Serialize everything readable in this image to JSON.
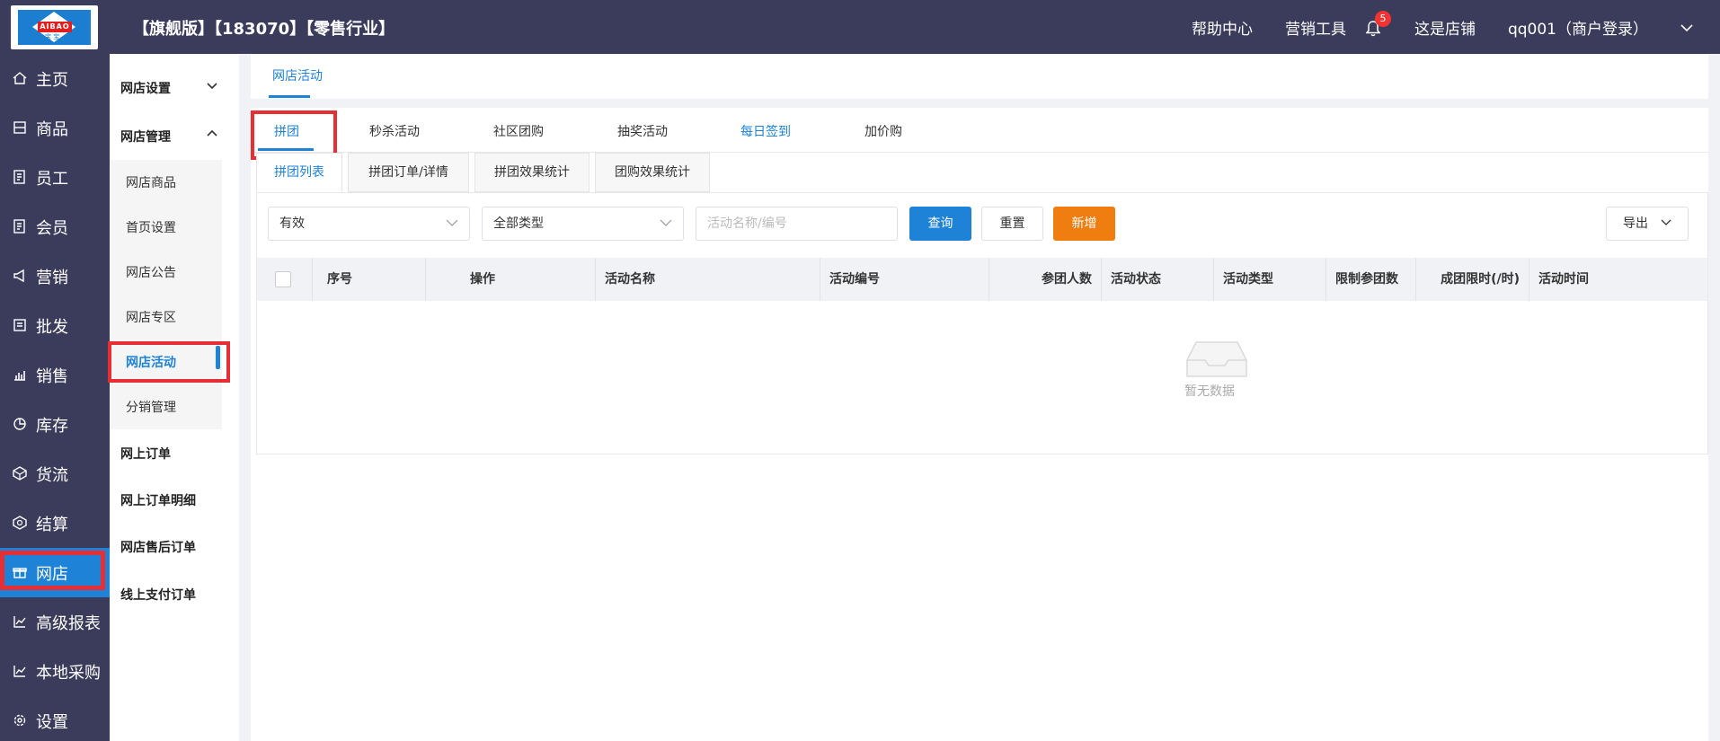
{
  "header": {
    "title": "【旗舰版】【183070】【零售行业】",
    "help": "帮助中心",
    "marketing_tools": "营销工具",
    "notification_count": "5",
    "store": "这是店铺",
    "user": "qq001（商户登录）"
  },
  "logo": {
    "text": "AIBAO",
    "sub": "宝 宝"
  },
  "nav": {
    "items": [
      {
        "label": "主页",
        "icon": "home-icon"
      },
      {
        "label": "商品",
        "icon": "goods-icon"
      },
      {
        "label": "员工",
        "icon": "staff-icon"
      },
      {
        "label": "会员",
        "icon": "member-icon"
      },
      {
        "label": "营销",
        "icon": "megaphone-icon"
      },
      {
        "label": "批发",
        "icon": "wholesale-icon"
      },
      {
        "label": "销售",
        "icon": "chart-icon"
      },
      {
        "label": "库存",
        "icon": "pie-icon"
      },
      {
        "label": "货流",
        "icon": "flow-icon"
      },
      {
        "label": "结算",
        "icon": "settle-icon"
      },
      {
        "label": "网店",
        "icon": "gift-icon"
      },
      {
        "label": "高级报表",
        "icon": "line-chart-icon"
      },
      {
        "label": "本地采购",
        "icon": "line-chart-icon"
      },
      {
        "label": "设置",
        "icon": "gear-icon"
      }
    ],
    "active": "网店"
  },
  "submenu": {
    "group1": "网店设置",
    "group2": "网店管理",
    "items": [
      "网店商品",
      "首页设置",
      "网店公告",
      "网店专区",
      "网店活动",
      "分销管理"
    ],
    "active": "网店活动",
    "links": [
      "网上订单",
      "网上订单明细",
      "网店售后订单",
      "线上支付订单"
    ]
  },
  "top_tab": "网店活动",
  "main_tabs": [
    "拼团",
    "秒杀活动",
    "社区团购",
    "抽奖活动",
    "每日签到",
    "加价购"
  ],
  "sub_tabs": [
    "拼团列表",
    "拼团订单/详情",
    "拼团效果统计",
    "团购效果统计"
  ],
  "filters": {
    "status": "有效",
    "type": "全部类型",
    "search_placeholder": "活动名称/编号",
    "query": "查询",
    "reset": "重置",
    "add": "新增",
    "export": "导出"
  },
  "table": {
    "columns": [
      "序号",
      "操作",
      "活动名称",
      "活动编号",
      "参团人数",
      "活动状态",
      "活动类型",
      "限制参团数",
      "成团限时(/时)",
      "活动时间"
    ],
    "empty": "暂无数据"
  }
}
